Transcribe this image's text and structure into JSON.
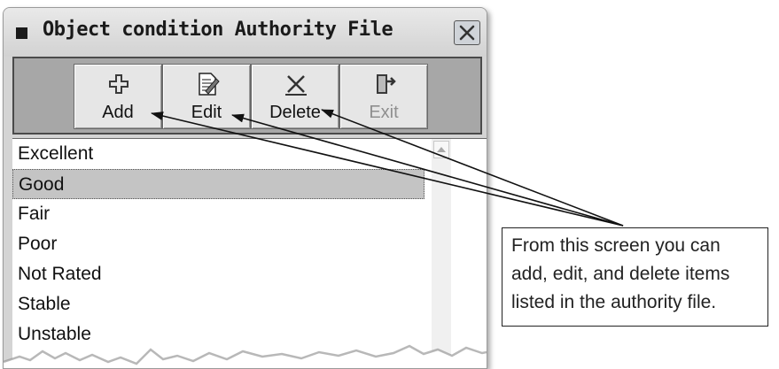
{
  "window": {
    "title": "Object condition Authority File"
  },
  "toolbar": {
    "buttons": [
      {
        "label": "Add",
        "icon": "plus-icon",
        "enabled": true
      },
      {
        "label": "Edit",
        "icon": "edit-document-icon",
        "enabled": true
      },
      {
        "label": "Delete",
        "icon": "delete-x-icon",
        "enabled": true
      },
      {
        "label": "Exit",
        "icon": "exit-door-icon",
        "enabled": false
      }
    ]
  },
  "list": {
    "items": [
      "Excellent",
      "Good",
      "Fair",
      "Poor",
      "Not Rated",
      "Stable",
      "Unstable"
    ],
    "selected_index": 1
  },
  "callout": {
    "lines": [
      "From this screen you can",
      "add, edit, and delete items",
      "listed in the authority file."
    ]
  },
  "colors": {
    "toolbar_bg": "#a7a7a7",
    "selection": "#c4c4c4"
  }
}
